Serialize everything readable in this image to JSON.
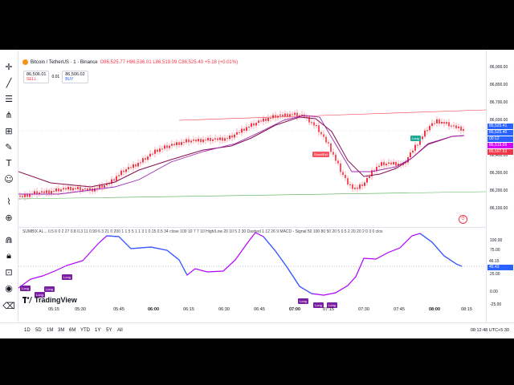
{
  "symbol": {
    "title": "Bitcoin / TetherUS · 1 · Binance",
    "ohlc": "O86,525.77 H86,536.01 L86,519.09 C86,525.40 +5.18 (+0.01%)"
  },
  "trade": {
    "sell_price": "86,506.01",
    "sell_label": "SELL",
    "spread": "0.01",
    "buy_price": "86,506.02",
    "buy_label": "BUY"
  },
  "price_axis": {
    "labels": [
      "86,900.00",
      "86,800.00",
      "86,700.00",
      "86,600.00",
      "86,400.00",
      "86,300.00",
      "86,200.00",
      "86,100.00"
    ],
    "tags": [
      {
        "text": "86,525.41",
        "color": "#2962ff"
      },
      {
        "text": "86,525.40",
        "color": "#2962ff"
      },
      {
        "text": "00:12",
        "color": "#2962ff"
      },
      {
        "text": "86,519.09",
        "color": "#d500f9"
      },
      {
        "text": "86,507.53",
        "color": "#f23645"
      }
    ]
  },
  "oscillator": {
    "legend": "SUMBIX AL...  0.5 6 0 2 27 0.8 0.3 11 0.99 6 3 21 0 200 1 1 5 5 1 1 3 1 0.15 0.5 34 close 100 10 7 7 10 High/Low 20 10 5 2 30 Dashed 1 12 26 9 MACD - Signal 50 100 80 50 20 5 0.5 2 20 20 2 0 3 0 clos",
    "axis_labels": [
      "100.00",
      "75.00",
      "25.00",
      "0.00",
      "-25.00"
    ],
    "tags": [
      {
        "text": "46.15",
        "color": "#ffffff"
      },
      {
        "text": "45.43",
        "color": "#2962ff"
      }
    ]
  },
  "badges": {
    "long": "Long",
    "short": "Short/Exit"
  },
  "time_axis": {
    "labels": [
      "05:15",
      "05:30",
      "05:45",
      "06:00",
      "06:15",
      "06:30",
      "06:45",
      "07:00",
      "07:15",
      "07:30",
      "07:45",
      "08:00",
      "08:15"
    ]
  },
  "logo": "TradingView",
  "range_buttons": [
    "1D",
    "5D",
    "1M",
    "3M",
    "6M",
    "YTD",
    "1Y",
    "5Y",
    "All"
  ],
  "clock": "08:12:48 UTC+5:30",
  "colors": {
    "up": "#f23645",
    "down": "#f23645",
    "ma": "#9c27b0",
    "ma2": "#880e4f",
    "channel_top": "#f23645",
    "channel_bottom": "#4caf50",
    "osc_up": "#b000ff",
    "osc_down": "#2962ff"
  },
  "icons": [
    "cursor-icon",
    "trend-line-icon",
    "fib-icon",
    "pattern-icon",
    "brush-icon",
    "text-icon",
    "emoji-icon",
    "ruler-icon",
    "zoom-icon",
    "magnet-icon",
    "lock-icon",
    "eye-icon",
    "trash-icon"
  ]
}
